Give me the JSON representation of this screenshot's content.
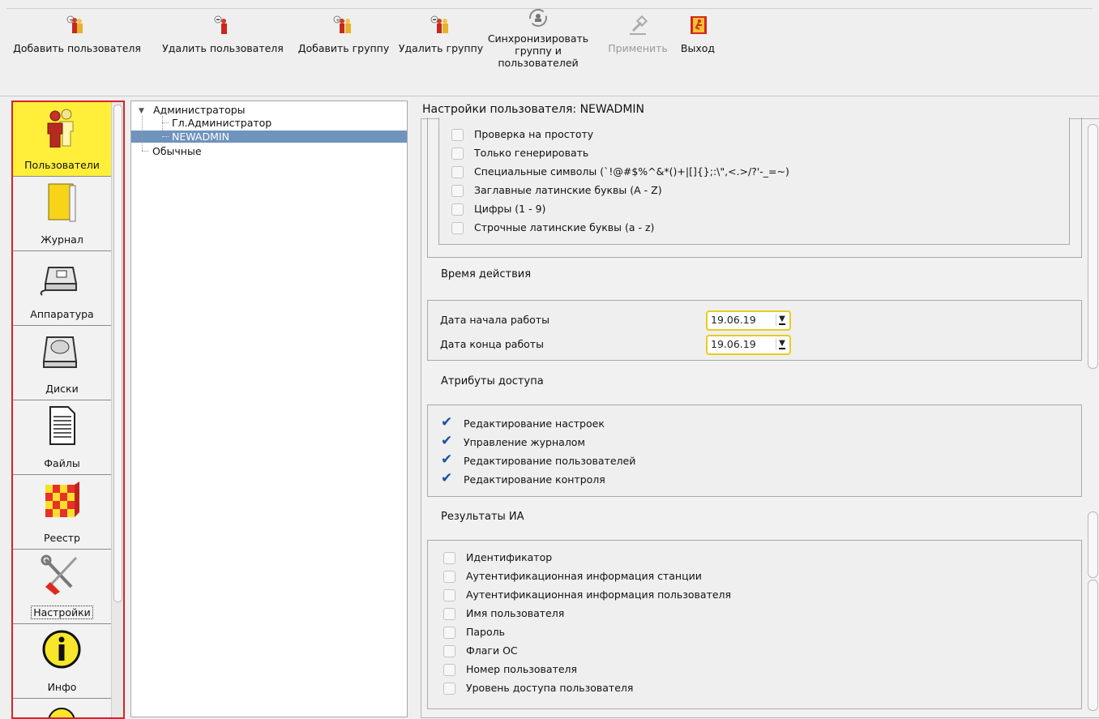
{
  "toolbar": {
    "add_user": "Добавить пользователя",
    "remove_user": "Удалить пользователя",
    "add_group": "Добавить группу",
    "remove_group": "Удалить группу",
    "sync_line1": "Синхронизировать",
    "sync_line2": "группу и",
    "sync_line3": "пользователей",
    "apply": "Применить",
    "exit": "Выход"
  },
  "nav": {
    "items": [
      {
        "label": "Пользователи",
        "icon": "users-icon"
      },
      {
        "label": "Журнал",
        "icon": "journal-icon"
      },
      {
        "label": "Аппаратура",
        "icon": "hardware-icon"
      },
      {
        "label": "Диски",
        "icon": "disk-icon"
      },
      {
        "label": "Файлы",
        "icon": "files-icon"
      },
      {
        "label": "Реестр",
        "icon": "registry-icon"
      },
      {
        "label": "Настройки",
        "icon": "settings-icon"
      },
      {
        "label": "Инфо",
        "icon": "info-icon"
      }
    ],
    "active": "Пользователи"
  },
  "tree": {
    "root": "Администраторы",
    "child1": "Гл.Администратор",
    "child2": "NEWADMIN",
    "root2": "Обычные"
  },
  "settings": {
    "title": "Настройки пользователя: NEWADMIN",
    "password_opts": [
      "Проверка на простоту",
      "Только генерировать",
      "Специальные символы (`!@#$%^&*()+|[]{};:\\\",<.>/?'-_=~)",
      "Заглавные латинские буквы (A - Z)",
      "Цифры (1 - 9)",
      "Строчные латинские буквы (a - z)"
    ],
    "validity_title": "Время действия",
    "start_label": "Дата начала работы",
    "start_value": "19.06.19",
    "end_label": "Дата конца работы",
    "end_value": "19.06.19",
    "access_title": "Атрибуты доступа",
    "access_opts": [
      "Редактирование настроек",
      "Управление журналом",
      "Редактирование пользователей",
      "Редактирование контроля"
    ],
    "results_title": "Результаты ИА",
    "results_opts": [
      "Идентификатор",
      "Аутентификационная информация станции",
      "Аутентификационная информация пользователя",
      "Имя пользователя",
      "Пароль",
      "Флаги ОС",
      "Номер пользователя",
      "Уровень доступа пользователя"
    ]
  },
  "colors": {
    "active_nav": "#ffef3a",
    "selection": "#6f93bd",
    "panel_border": "#d9232d",
    "check": "#1c4f9e"
  }
}
